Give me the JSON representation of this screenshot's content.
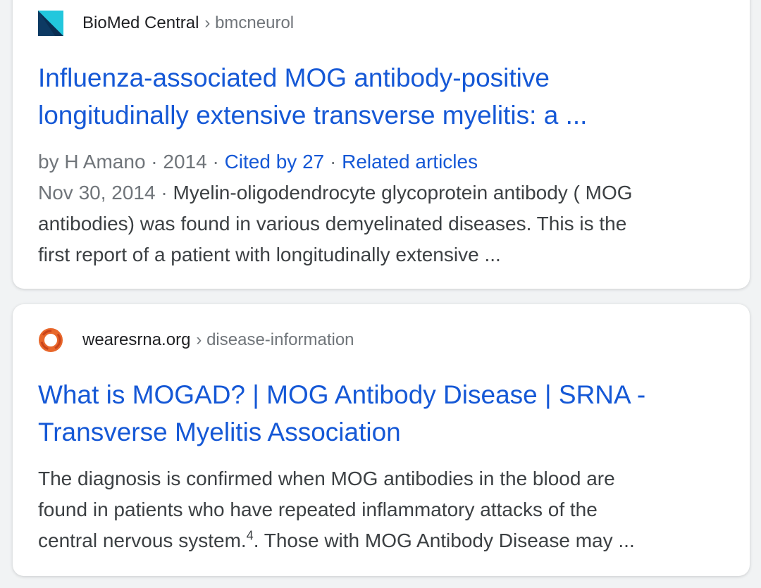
{
  "results": [
    {
      "site_name": "BioMed Central",
      "breadcrumb": "› bmcneurol",
      "favicon": "bmc-logo-icon",
      "title_line1": "Influenza-associated MOG antibody-positive",
      "title_line2": "longitudinally extensive transverse myelitis: a ...",
      "byline": "by H Amano · 2014 · ",
      "cited_by": "Cited by 27",
      "separator": " · ",
      "related": "Related articles",
      "date": "Nov 30, 2014 · ",
      "snippet_line1": "Myelin-oligodendrocyte glycoprotein antibody ( MOG",
      "snippet_line2": "antibodies) was found in various demyelinated diseases. This is the",
      "snippet_line3": "first report of a patient with longitudinally extensive ..."
    },
    {
      "site_name": "wearesrna.org",
      "breadcrumb": "› disease-information",
      "favicon": "srna-ring-icon",
      "title_line1": "What is MOGAD? | MOG Antibody Disease | SRNA -",
      "title_line2": "Transverse Myelitis Association",
      "snippet_line1": "The diagnosis is confirmed when MOG antibodies in the blood are",
      "snippet_line2": "found in patients who have repeated inflammatory attacks of the",
      "snippet_line3a": "central nervous system.",
      "snippet_sup": "4",
      "snippet_line3b": ". Those with MOG Antibody Disease may  ..."
    }
  ],
  "colors": {
    "link": "#1558d6",
    "text": "#3c4043",
    "muted": "#70757a",
    "bmc_dark": "#0a2e52",
    "bmc_cyan": "#22c7dd",
    "srna_orange": "#e8672b"
  }
}
